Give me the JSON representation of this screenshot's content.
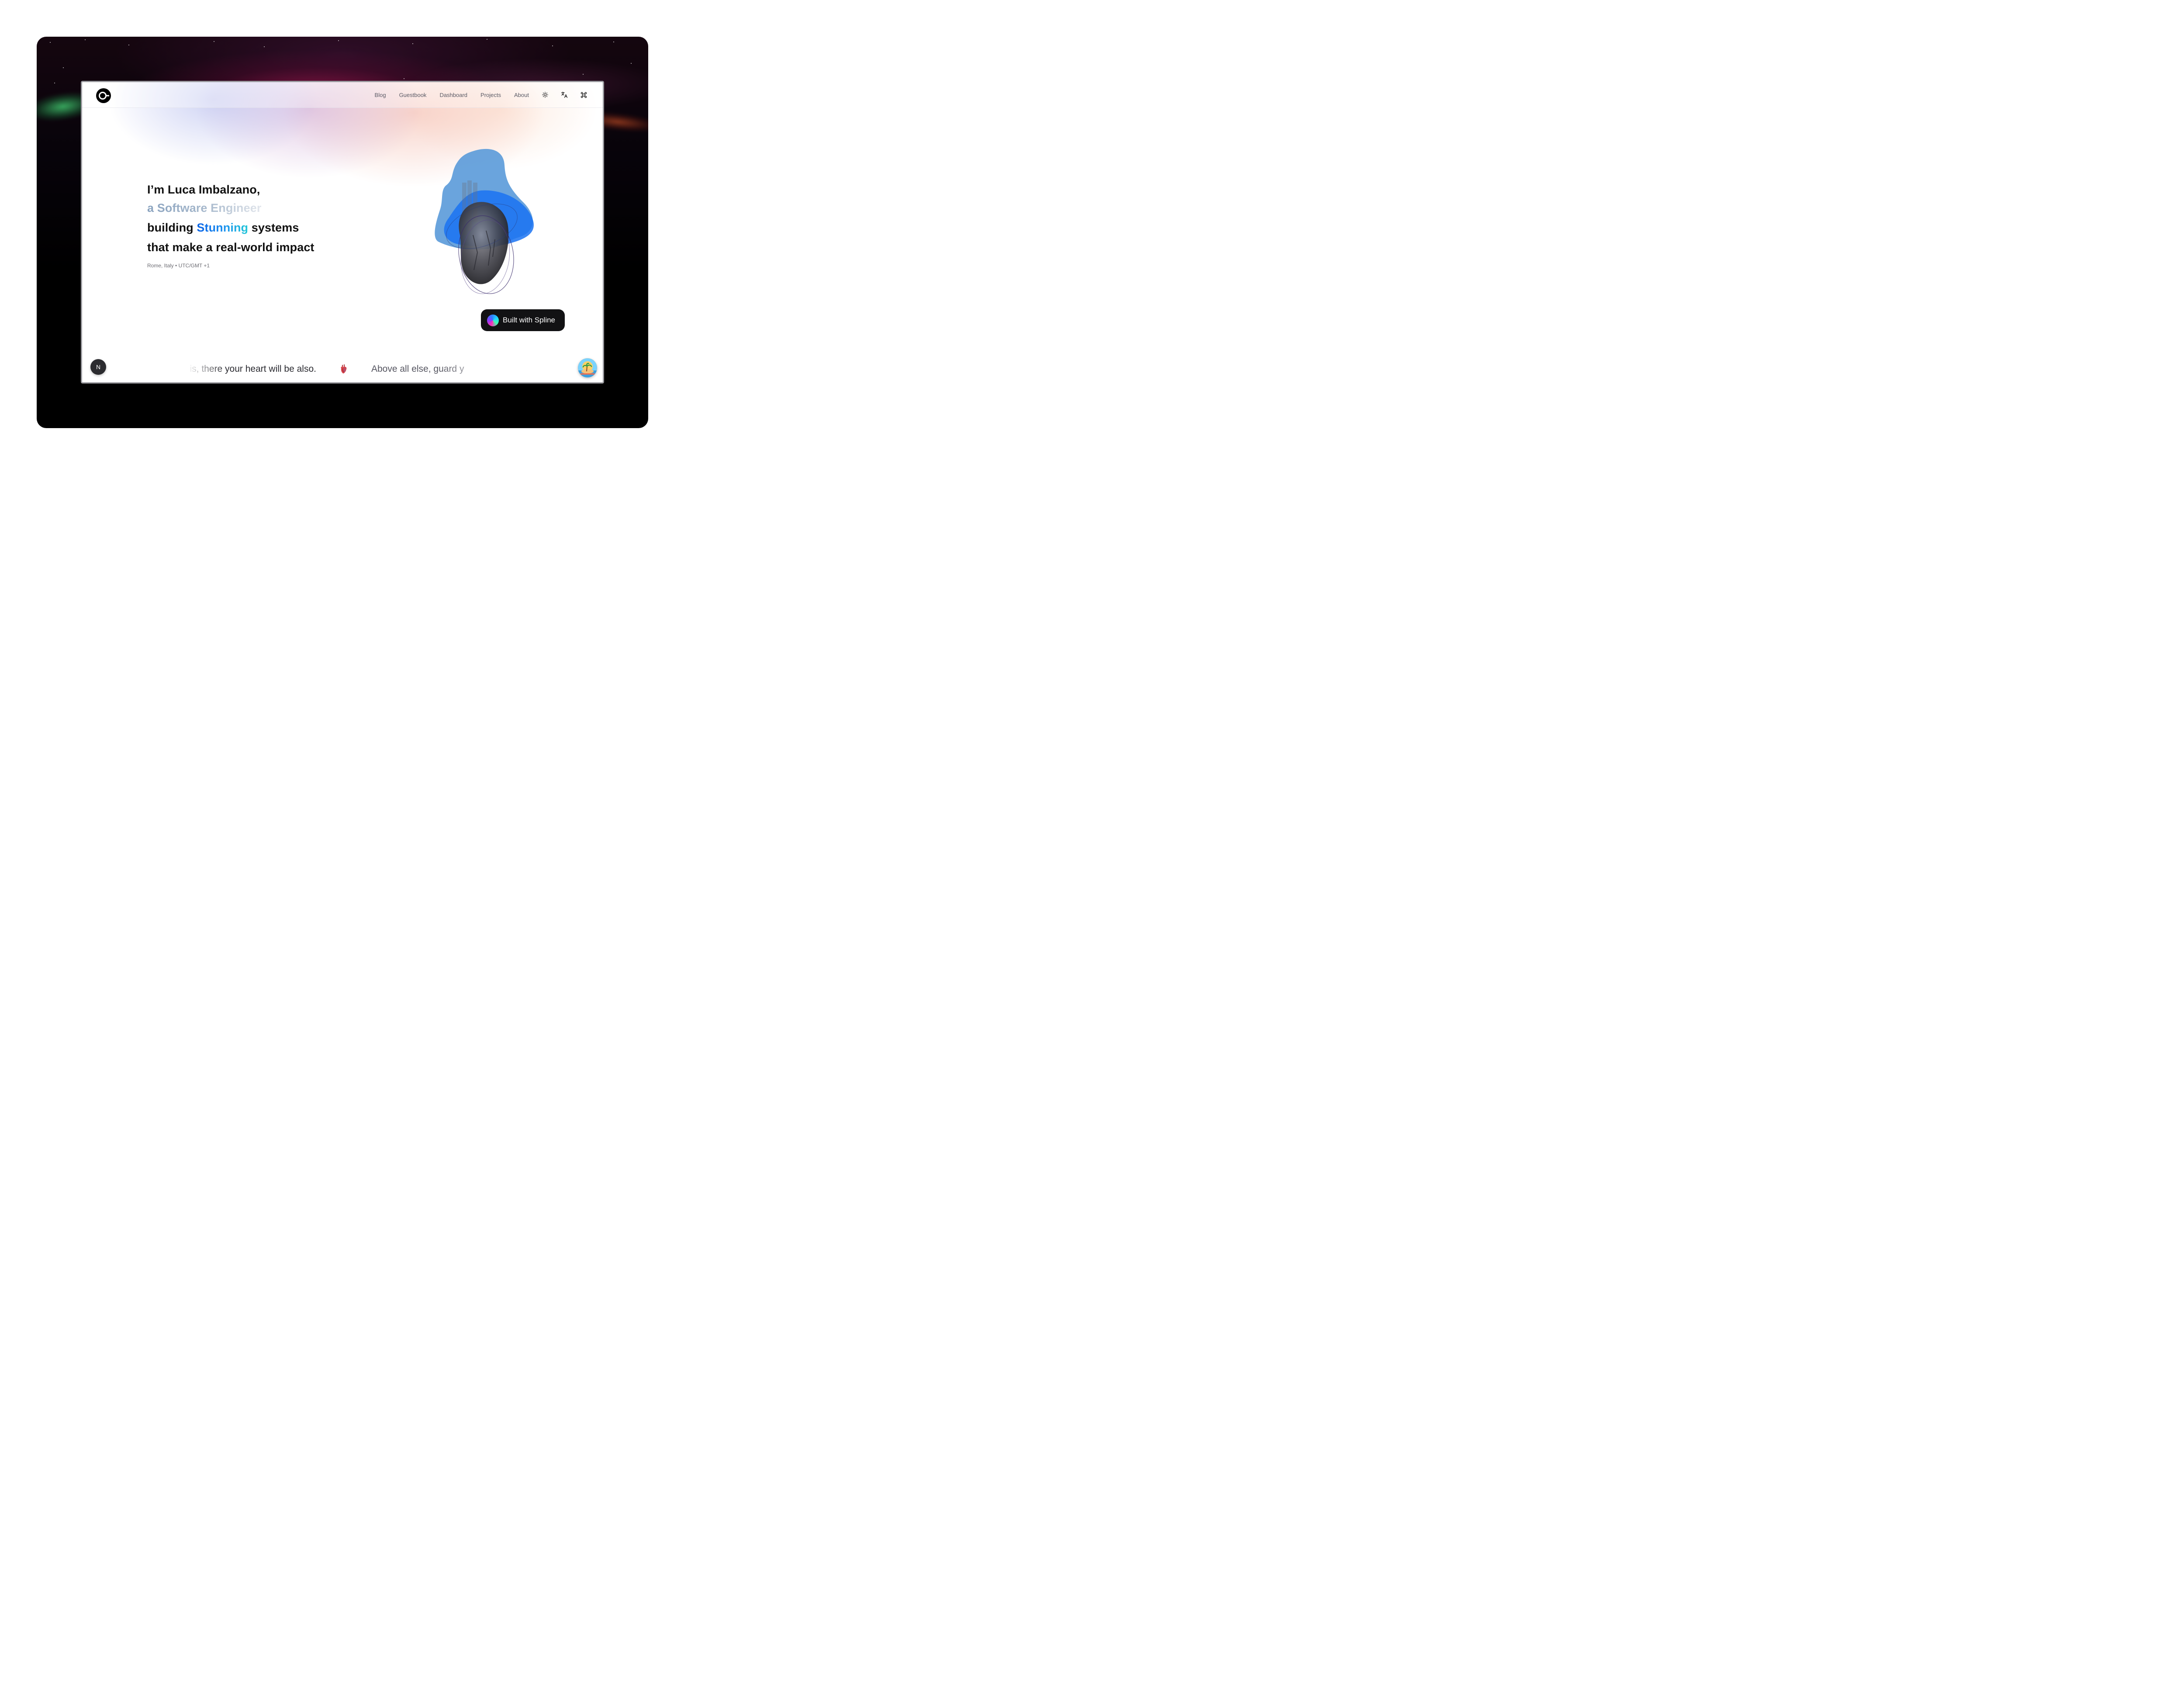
{
  "nav": {
    "logo_icon": "circle-logo-icon",
    "links": [
      "Blog",
      "Guestbook",
      "Dashboard",
      "Projects",
      "About"
    ],
    "icons": [
      "sun-icon",
      "translate-icon",
      "command-icon"
    ]
  },
  "hero": {
    "line1": "I’m Luca Imbalzano,",
    "line2": "a Software Engineer",
    "line3_before": "building ",
    "line3_highlight": "Stunning",
    "line3_after": " systems",
    "line4": "that make a real-world impact",
    "location": "Rome, Italy • UTC/GMT +1"
  },
  "spline_badge": {
    "label": "Built with Spline"
  },
  "marquee": {
    "item1": "re is, there your heart will be also.",
    "item2": "Above all else, guard y"
  },
  "corner": {
    "next_badge_label": "N"
  },
  "colors": {
    "highlight_start": "#0a63e6",
    "highlight_end": "#22c8d8",
    "badge_bg": "#121214"
  }
}
